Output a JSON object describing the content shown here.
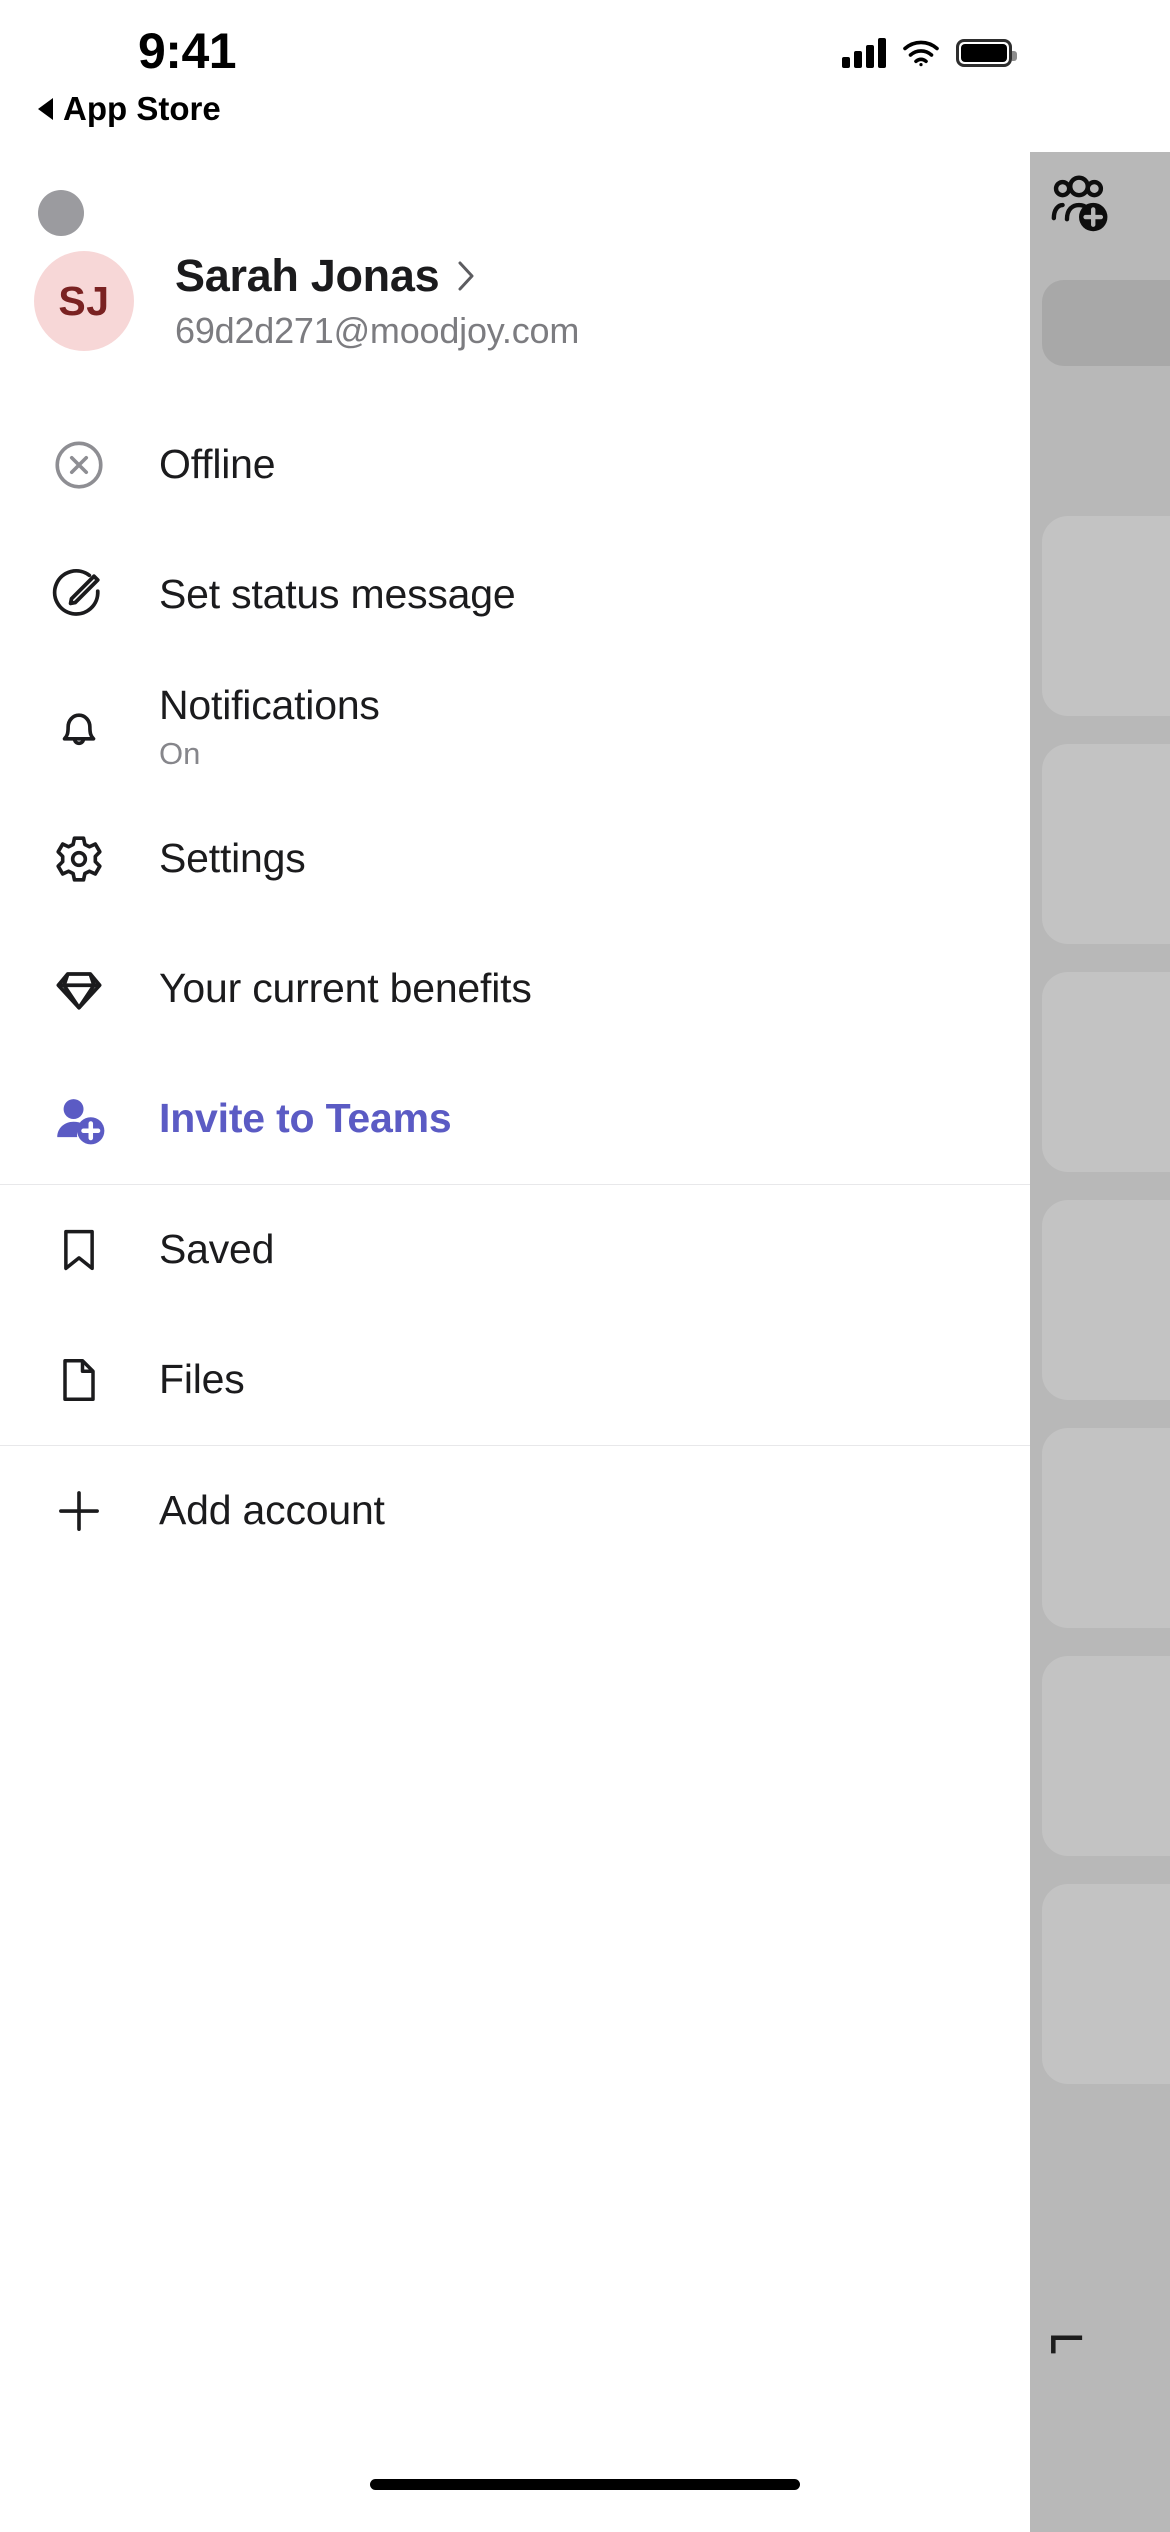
{
  "status_bar": {
    "time": "9:41",
    "back_label": "App Store",
    "icons": [
      "cellular-signal-icon",
      "wifi-icon",
      "battery-icon"
    ]
  },
  "profile": {
    "avatar_initials": "SJ",
    "avatar_bg": "#f7d7d7",
    "avatar_fg": "#7a2222",
    "name": "Sarah Jonas",
    "email": "69d2d271@moodjoy.com",
    "chevron": "chevron-right-icon"
  },
  "menu": {
    "groups": [
      {
        "items": [
          {
            "id": "status",
            "icon": "status-offline-icon",
            "label": "Offline",
            "sub": "",
            "accent": false
          },
          {
            "id": "set-status-message",
            "icon": "edit-pencil-circle-icon",
            "label": "Set status message",
            "sub": "",
            "accent": false
          },
          {
            "id": "notifications",
            "icon": "bell-icon",
            "label": "Notifications",
            "sub": "On",
            "accent": false
          },
          {
            "id": "settings",
            "icon": "gear-icon",
            "label": "Settings",
            "sub": "",
            "accent": false
          },
          {
            "id": "benefits",
            "icon": "diamond-icon",
            "label": "Your current benefits",
            "sub": "",
            "accent": false
          },
          {
            "id": "invite",
            "icon": "person-add-icon",
            "label": "Invite to Teams",
            "sub": "",
            "accent": true
          }
        ]
      },
      {
        "items": [
          {
            "id": "saved",
            "icon": "bookmark-icon",
            "label": "Saved",
            "sub": "",
            "accent": false
          },
          {
            "id": "files",
            "icon": "file-document-icon",
            "label": "Files",
            "sub": "",
            "accent": false
          }
        ]
      },
      {
        "items": [
          {
            "id": "add-account",
            "icon": "plus-icon",
            "label": "Add account",
            "sub": "",
            "accent": false
          }
        ]
      }
    ]
  },
  "backdrop": {
    "add_team_icon": "add-team-icon",
    "dimmed": true
  },
  "colors": {
    "accent": "#5b5bc4",
    "text_primary": "#1b1b1d",
    "text_secondary": "#86868b",
    "divider": "#e8e8ea",
    "panel_bg": "#ffffff",
    "backdrop_bg": "#b8b8b8"
  }
}
